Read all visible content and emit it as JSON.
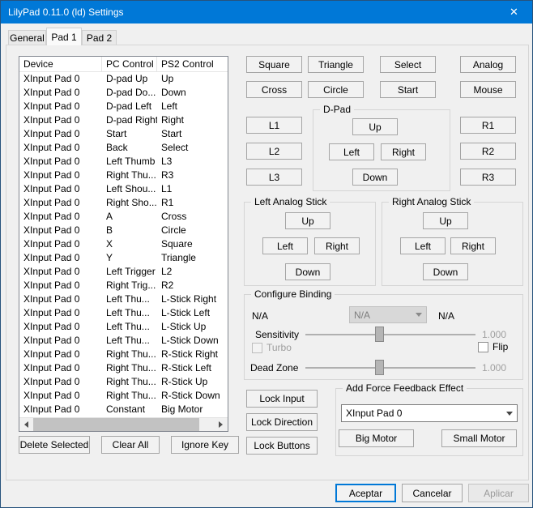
{
  "window": {
    "title": "LilyPad 0.11.0 (ld) Settings"
  },
  "icons": {
    "close": "✕"
  },
  "colors": {
    "titlebar": "#0078d7",
    "accent": "#0078d7"
  },
  "tabs": {
    "general": "General",
    "pad1": "Pad 1",
    "pad2": "Pad 2"
  },
  "bindings": {
    "columns": [
      "Device",
      "PC Control",
      "PS2 Control"
    ],
    "rows": [
      [
        "XInput Pad 0",
        "D-pad Up",
        "Up"
      ],
      [
        "XInput Pad 0",
        "D-pad Do...",
        "Down"
      ],
      [
        "XInput Pad 0",
        "D-pad Left",
        "Left"
      ],
      [
        "XInput Pad 0",
        "D-pad Right",
        "Right"
      ],
      [
        "XInput Pad 0",
        "Start",
        "Start"
      ],
      [
        "XInput Pad 0",
        "Back",
        "Select"
      ],
      [
        "XInput Pad 0",
        "Left Thumb",
        "L3"
      ],
      [
        "XInput Pad 0",
        "Right Thu...",
        "R3"
      ],
      [
        "XInput Pad 0",
        "Left Shou...",
        "L1"
      ],
      [
        "XInput Pad 0",
        "Right Sho...",
        "R1"
      ],
      [
        "XInput Pad 0",
        "A",
        "Cross"
      ],
      [
        "XInput Pad 0",
        "B",
        "Circle"
      ],
      [
        "XInput Pad 0",
        "X",
        "Square"
      ],
      [
        "XInput Pad 0",
        "Y",
        "Triangle"
      ],
      [
        "XInput Pad 0",
        "Left Trigger",
        "L2"
      ],
      [
        "XInput Pad 0",
        "Right Trig...",
        "R2"
      ],
      [
        "XInput Pad 0",
        "Left Thu...",
        "L-Stick Right"
      ],
      [
        "XInput Pad 0",
        "Left Thu...",
        "L-Stick Left"
      ],
      [
        "XInput Pad 0",
        "Left Thu...",
        "L-Stick Up"
      ],
      [
        "XInput Pad 0",
        "Left Thu...",
        "L-Stick Down"
      ],
      [
        "XInput Pad 0",
        "Right Thu...",
        "R-Stick Right"
      ],
      [
        "XInput Pad 0",
        "Right Thu...",
        "R-Stick Left"
      ],
      [
        "XInput Pad 0",
        "Right Thu...",
        "R-Stick Up"
      ],
      [
        "XInput Pad 0",
        "Right Thu...",
        "R-Stick Down"
      ],
      [
        "XInput Pad 0",
        "Constant",
        "Big Motor"
      ]
    ]
  },
  "pad_buttons": {
    "square": "Square",
    "triangle": "Triangle",
    "select": "Select",
    "analog": "Analog",
    "cross": "Cross",
    "circle": "Circle",
    "start": "Start",
    "mouse": "Mouse",
    "l1": "L1",
    "l2": "L2",
    "l3": "L3",
    "r1": "R1",
    "r2": "R2",
    "r3": "R3"
  },
  "dpad": {
    "title": "D-Pad",
    "up": "Up",
    "left": "Left",
    "right": "Right",
    "down": "Down"
  },
  "left_stick": {
    "title": "Left Analog Stick",
    "up": "Up",
    "left": "Left",
    "right": "Right",
    "down": "Down"
  },
  "right_stick": {
    "title": "Right Analog Stick",
    "up": "Up",
    "left": "Left",
    "right": "Right",
    "down": "Down"
  },
  "configure": {
    "title": "Configure Binding",
    "device_label": "N/A",
    "binding_value": "N/A",
    "key_label": "N/A",
    "sensitivity_label": "Sensitivity",
    "sensitivity_value": "1.000",
    "turbo_label": "Turbo",
    "flip_label": "Flip",
    "deadzone_label": "Dead Zone",
    "deadzone_value": "1.000"
  },
  "locks": {
    "input": "Lock Input",
    "direction": "Lock Direction",
    "buttons": "Lock Buttons"
  },
  "force_feedback": {
    "title": "Add Force Feedback Effect",
    "device_value": "XInput Pad 0",
    "big_motor": "Big Motor",
    "small_motor": "Small Motor"
  },
  "list_actions": {
    "delete_selected": "Delete Selected",
    "clear_all": "Clear All",
    "ignore_key": "Ignore Key"
  },
  "dialog": {
    "ok": "Aceptar",
    "cancel": "Cancelar",
    "apply": "Aplicar"
  }
}
